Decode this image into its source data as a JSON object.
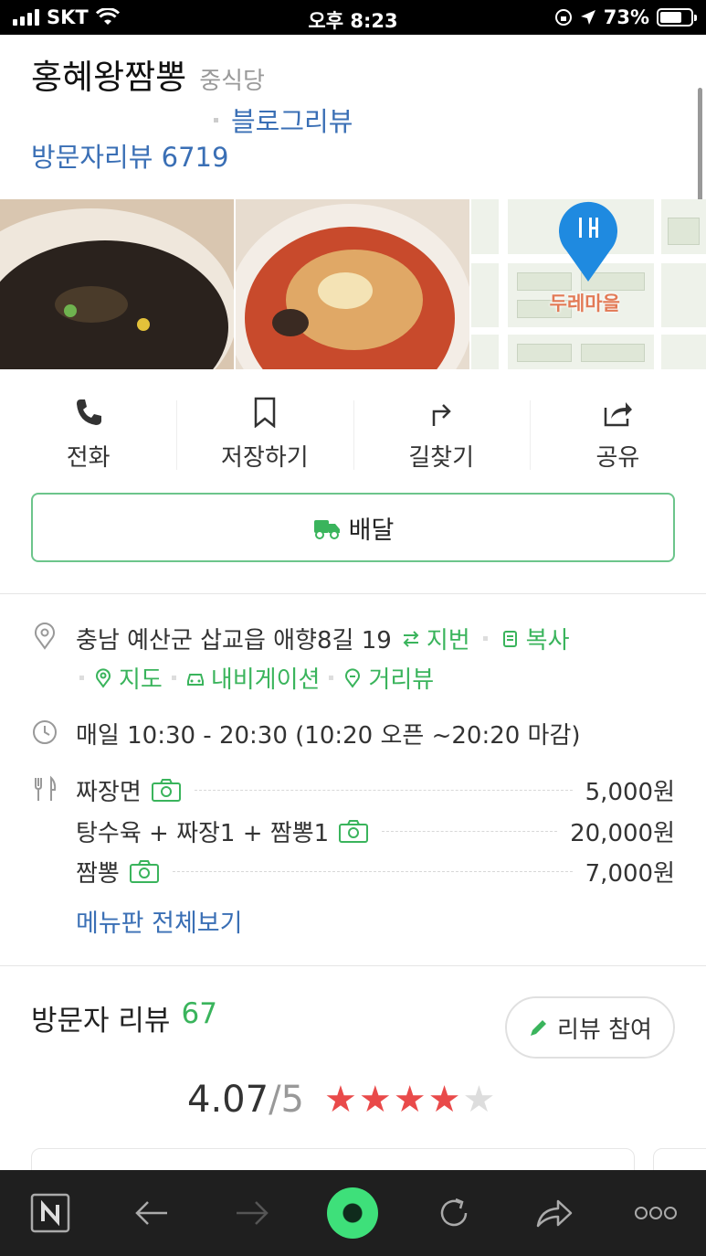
{
  "status_bar": {
    "carrier": "SKT",
    "time": "오후 8:23",
    "battery": "73%"
  },
  "place": {
    "name": "홍혜왕짬뽕",
    "category": "중식당",
    "blog_review_label": "블로그리뷰",
    "visitor_review_label": "방문자리뷰 6719"
  },
  "photos": {
    "map_label": "두레마을"
  },
  "actions": [
    {
      "label": "전화",
      "icon": "phone-icon"
    },
    {
      "label": "저장하기",
      "icon": "bookmark-icon"
    },
    {
      "label": "길찾기",
      "icon": "directions-icon"
    },
    {
      "label": "공유",
      "icon": "share-icon"
    }
  ],
  "delivery": {
    "label": "배달",
    "icon": "delivery-truck-icon"
  },
  "info": {
    "address": "충남 예산군 삽교읍 애향8길 19",
    "jibun_label": "지번",
    "copy_label": "복사",
    "map_label": "지도",
    "navigation_label": "내비게이션",
    "streetview_label": "거리뷰",
    "hours": "매일 10:30 - 20:30 (10:20 오픈 ~20:20 마감)"
  },
  "menu": {
    "items": [
      {
        "name": "짜장면",
        "price": "5,000원"
      },
      {
        "name": "탕수육 + 짜장1 + 짬뽕1",
        "price": "20,000원"
      },
      {
        "name": "짬뽕",
        "price": "7,000원"
      }
    ],
    "view_all_label": "메뉴판 전체보기"
  },
  "reviews": {
    "title": "방문자 리뷰",
    "count": "67",
    "write_label": "리뷰 참여",
    "rating": "4.07",
    "rating_max": "/5",
    "rating_value": 4.07,
    "star_color": "#e94a4a"
  },
  "colors": {
    "accent_green": "#3ab45c",
    "link_blue": "#3a6fb5"
  }
}
